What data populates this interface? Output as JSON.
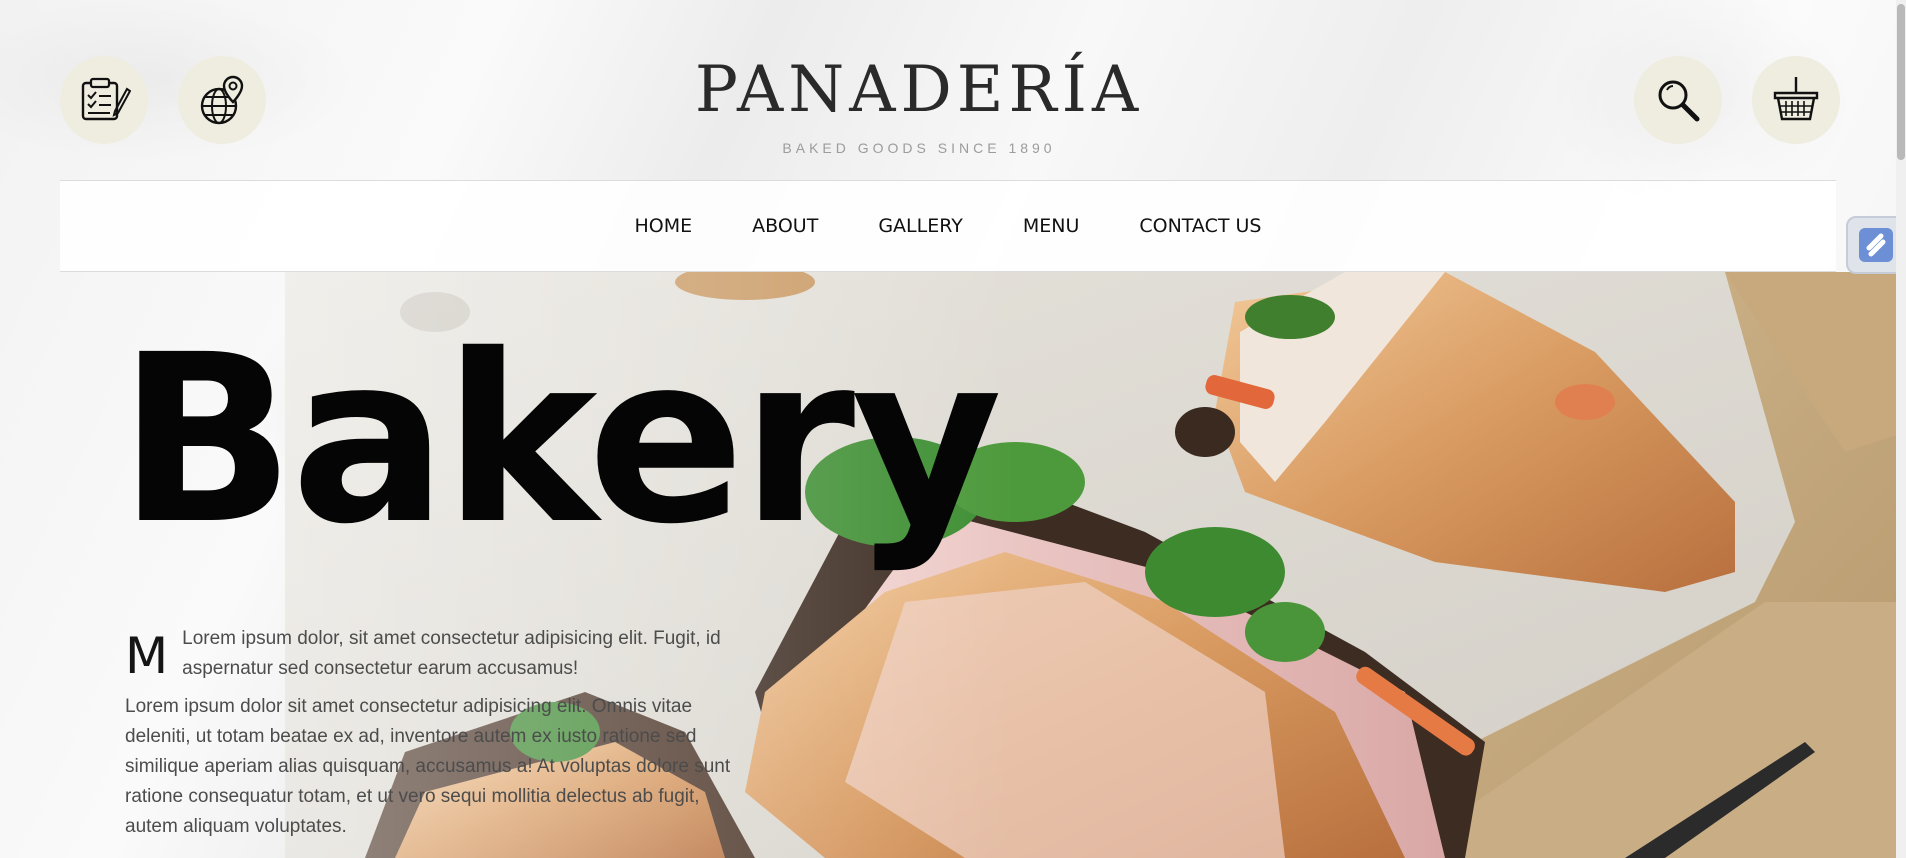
{
  "header": {
    "logo_title": "PANADERÍA",
    "logo_subtitle": "BAKED GOODS SINCE 1890",
    "left_icons": [
      "checklist-icon",
      "globe-location-icon"
    ],
    "right_icons": [
      "search-icon",
      "basket-icon"
    ]
  },
  "nav": {
    "items": [
      {
        "label": "HOME"
      },
      {
        "label": "ABOUT"
      },
      {
        "label": "GALLERY"
      },
      {
        "label": "MENU"
      },
      {
        "label": "CONTACT US"
      }
    ]
  },
  "hero": {
    "title": "Bakery",
    "drop_cap": "M",
    "lead": "Lorem ipsum dolor, sit amet consectetur adipisicing elit. Fugit, id aspernatur sed consectetur earum accusamus!",
    "body": "Lorem ipsum dolor sit amet consectetur adipisicing elit. Omnis vitae deleniti, ut totam beatae ex ad, inventore autem ex iusto ratione sed similique aperiam alias quisquam, accusamus a! At voluptas dolore sunt ratione consequatur totam, et ut vero sequi mollitia delectus ab fugit, autem aliquam voluptates."
  },
  "colors": {
    "icon_circle_bg": "#efece0",
    "text_dark": "#050505",
    "text_body": "#4c4c4c",
    "subtitle": "#9c9c9c"
  }
}
